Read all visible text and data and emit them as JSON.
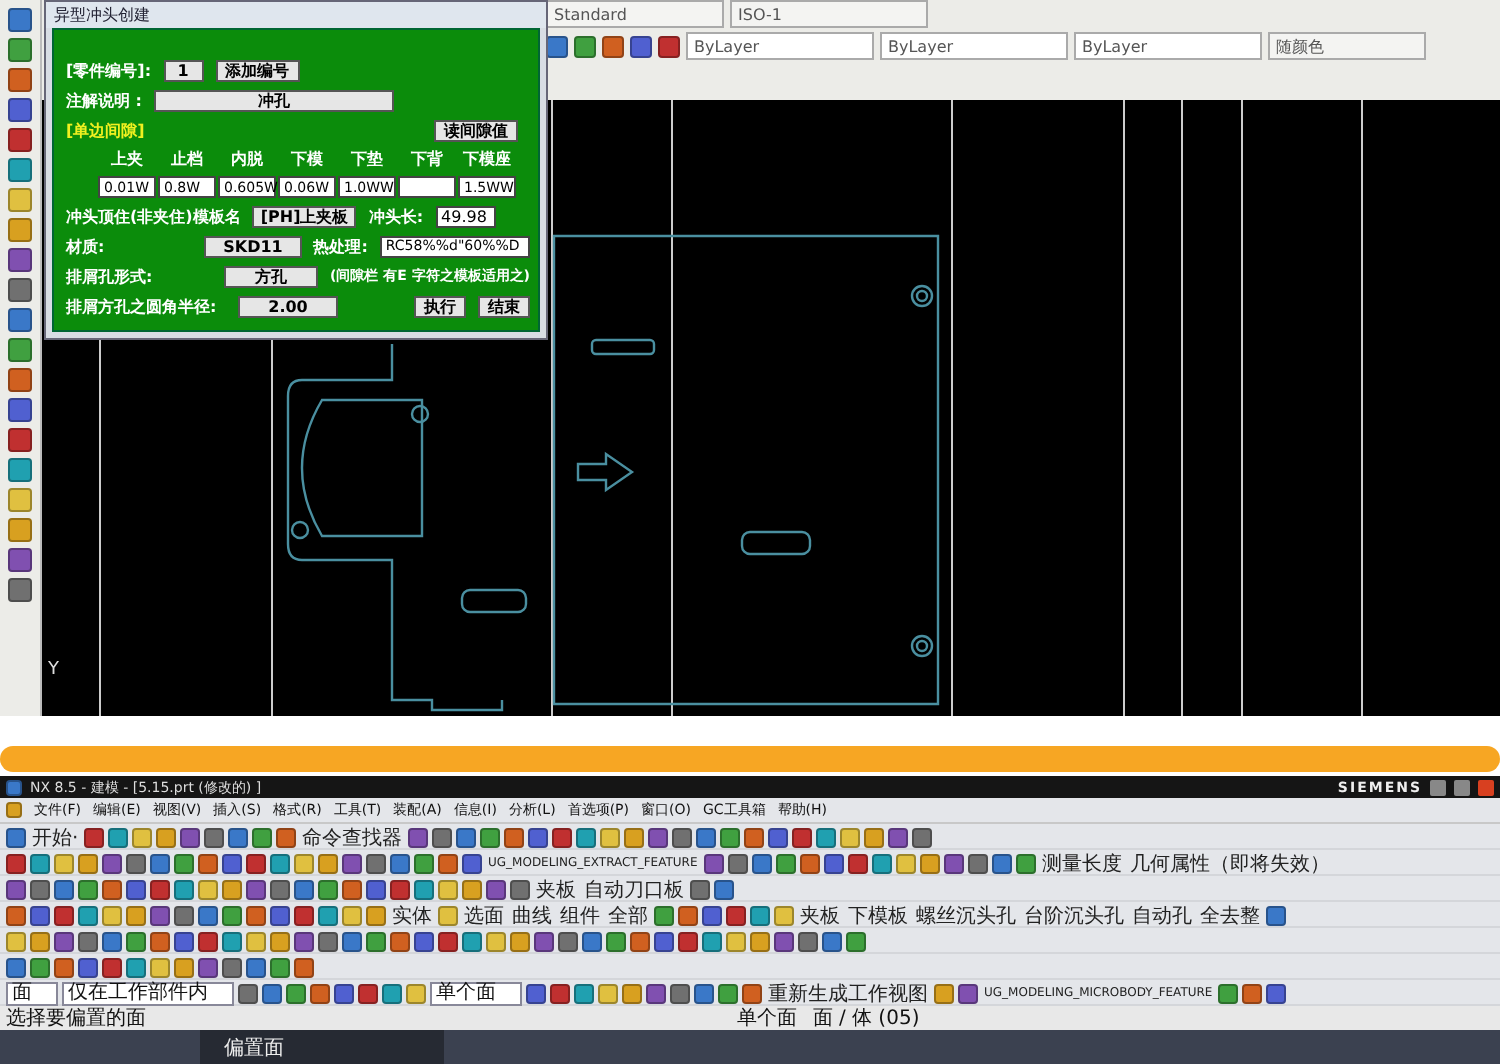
{
  "cad": {
    "toolbar": {
      "row_1": [
        "Standard",
        "ISO-1"
      ],
      "row_2": [
        "ByLayer",
        "ByLayer",
        "ByLayer",
        "随颜色"
      ]
    },
    "canvas": {
      "axis_label": "Y"
    }
  },
  "dialog": {
    "title": "异型冲头创建",
    "part_number": {
      "label": "[零件编号]:",
      "value": "1",
      "button": "添加编号"
    },
    "note": {
      "label": "注解说明 :",
      "value": "冲孔"
    },
    "clearance": {
      "label": "[单边间隙]",
      "button": "读间隙值",
      "columns": [
        {
          "label": "上夹",
          "value": "0.01W"
        },
        {
          "label": "止档",
          "value": "0.8W"
        },
        {
          "label": "内脱",
          "value": "0.605W"
        },
        {
          "label": "下模",
          "value": "0.06W"
        },
        {
          "label": "下垫",
          "value": "1.0WW"
        },
        {
          "label": "下背"
        },
        {
          "label": "下模座",
          "value": "1.5WW"
        }
      ]
    },
    "punch_plate": {
      "label": "冲头顶住(非夹住)模板名",
      "value": "[PH]上夹板",
      "length_label": "冲头长:",
      "length_value": "49.98"
    },
    "material": {
      "label": "材质:",
      "value": "SKD11",
      "heat_label": "热处理:",
      "heat_value": "RC58%%d\"60%%D"
    },
    "hole_form": {
      "label": "排屑孔形式:",
      "value": "方孔",
      "note": "(间隙栏 有E 字符之模板适用之)"
    },
    "radius": {
      "label": "排屑方孔之圆角半径:",
      "value": "2.00"
    },
    "buttons": [
      "执行",
      "结束"
    ]
  },
  "nx": {
    "title": "NX 8.5 - 建模 - [5.15.prt (修改的) ]",
    "brand": "SIEMENS",
    "menu": [
      "文件(F)",
      "编辑(E)",
      "视图(V)",
      "插入(S)",
      "格式(R)",
      "工具(T)",
      "装配(A)",
      "信息(I)",
      "分析(L)",
      "首选项(P)",
      "窗口(O)",
      "GC工具箱",
      "帮助(H)"
    ],
    "toolbar_rows": [
      [
        {
          "kind": "icons"
        },
        {
          "kind": "label",
          "text": "开始·"
        },
        {
          "kind": "icons"
        },
        {
          "kind": "label",
          "text": "命令查找器"
        },
        {
          "kind": "icons"
        }
      ],
      [
        {
          "kind": "icons"
        },
        {
          "kind": "label",
          "text": "UG_MODELING_EXTRACT_FEATURE"
        },
        {
          "kind": "icons"
        },
        {
          "kind": "label",
          "text": "测量长度"
        },
        {
          "kind": "label",
          "text": "几何属性（即将失效）"
        }
      ],
      [
        {
          "kind": "icons"
        },
        {
          "kind": "label",
          "text": "夹板"
        },
        {
          "kind": "label",
          "text": "自动刀口板"
        },
        {
          "kind": "icons"
        }
      ],
      [
        {
          "kind": "icons"
        },
        {
          "kind": "label",
          "text": "实体"
        },
        {
          "kind": "icons"
        },
        {
          "kind": "label",
          "text": "选面"
        },
        {
          "kind": "label",
          "text": "曲线"
        },
        {
          "kind": "label",
          "text": "组件"
        },
        {
          "kind": "label",
          "text": "全部"
        },
        {
          "kind": "icons"
        },
        {
          "kind": "label",
          "text": "夹板"
        },
        {
          "kind": "label",
          "text": "下模板"
        },
        {
          "kind": "label",
          "text": "螺丝沉头孔"
        },
        {
          "kind": "label",
          "text": "台阶沉头孔"
        },
        {
          "kind": "label",
          "text": "自动孔"
        },
        {
          "kind": "label",
          "text": "全去整"
        },
        {
          "kind": "icons"
        }
      ],
      [
        {
          "kind": "icons"
        }
      ],
      [
        {
          "kind": "icons"
        }
      ]
    ],
    "filter_bar": [
      {
        "kind": "combo",
        "text": "面"
      },
      {
        "kind": "combo",
        "text": "仅在工作部件内"
      },
      {
        "kind": "icons"
      },
      {
        "kind": "combo",
        "text": "单个面"
      },
      {
        "kind": "icons"
      },
      {
        "kind": "label",
        "text": "重新生成工作视图"
      },
      {
        "kind": "icons"
      },
      {
        "kind": "label",
        "text": "UG_MODELING_MICROBODY_FEATURE"
      },
      {
        "kind": "icons"
      }
    ],
    "status": {
      "prompt": "选择要偏置的面",
      "filter": "单个面",
      "count": "面 / 体 (05)"
    },
    "viewport": {
      "dialog_title": "偏置面"
    }
  }
}
